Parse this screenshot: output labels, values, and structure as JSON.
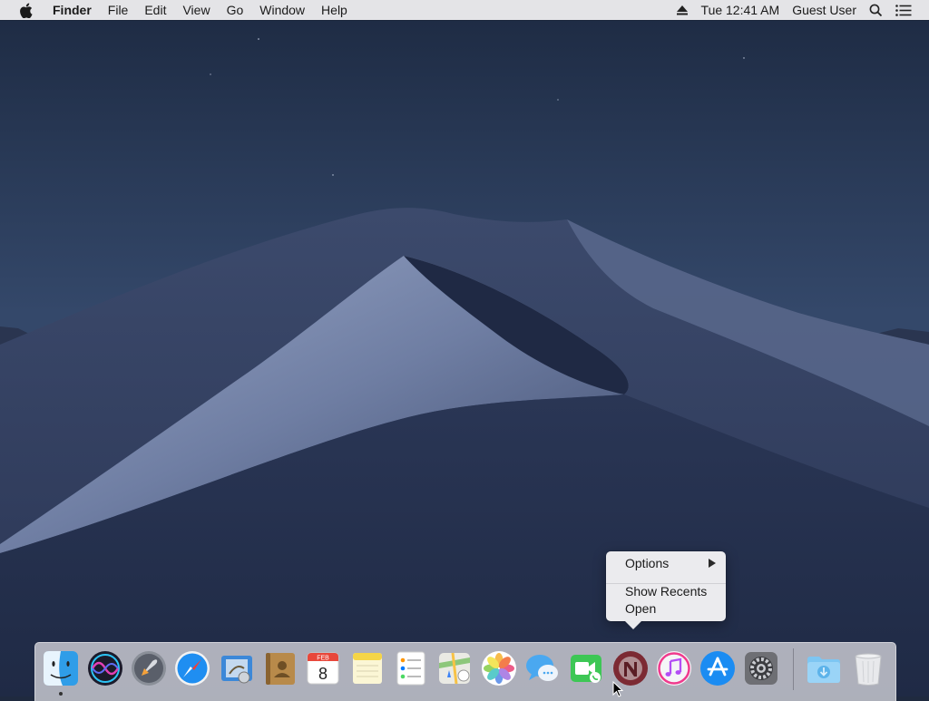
{
  "menubar": {
    "app_name": "Finder",
    "menus": [
      "File",
      "Edit",
      "View",
      "Go",
      "Window",
      "Help"
    ],
    "datetime": "Tue 12:41 AM",
    "user": "Guest User"
  },
  "context_menu": {
    "options_label": "Options",
    "show_recents_label": "Show Recents",
    "open_label": "Open"
  },
  "dock": {
    "apps": [
      {
        "name": "Finder",
        "icon": "finder-icon",
        "running": true
      },
      {
        "name": "Siri",
        "icon": "siri-icon"
      },
      {
        "name": "Launchpad",
        "icon": "launchpad-icon"
      },
      {
        "name": "Safari",
        "icon": "safari-icon"
      },
      {
        "name": "Mail",
        "icon": "mail-icon"
      },
      {
        "name": "Contacts",
        "icon": "contacts-icon"
      },
      {
        "name": "Calendar",
        "icon": "calendar-icon",
        "month": "FEB",
        "day": "8"
      },
      {
        "name": "Notes",
        "icon": "notes-icon"
      },
      {
        "name": "Reminders",
        "icon": "reminders-icon"
      },
      {
        "name": "Maps",
        "icon": "maps-icon"
      },
      {
        "name": "Photos",
        "icon": "photos-icon"
      },
      {
        "name": "Messages",
        "icon": "messages-icon"
      },
      {
        "name": "FaceTime",
        "icon": "facetime-icon"
      },
      {
        "name": "News",
        "icon": "news-icon"
      },
      {
        "name": "iTunes",
        "icon": "itunes-icon"
      },
      {
        "name": "App Store",
        "icon": "app-store-icon"
      },
      {
        "name": "System Preferences",
        "icon": "system-preferences-icon"
      }
    ],
    "folders": [
      {
        "name": "Downloads",
        "icon": "downloads-folder-icon"
      },
      {
        "name": "Trash",
        "icon": "trash-icon"
      }
    ]
  },
  "colors": {
    "sky_top": "#22304a",
    "sky_bottom": "#3e5070",
    "dune_light": "#8f9dbd",
    "dune_dark": "#26324f",
    "menubar_bg": "#ececee"
  }
}
